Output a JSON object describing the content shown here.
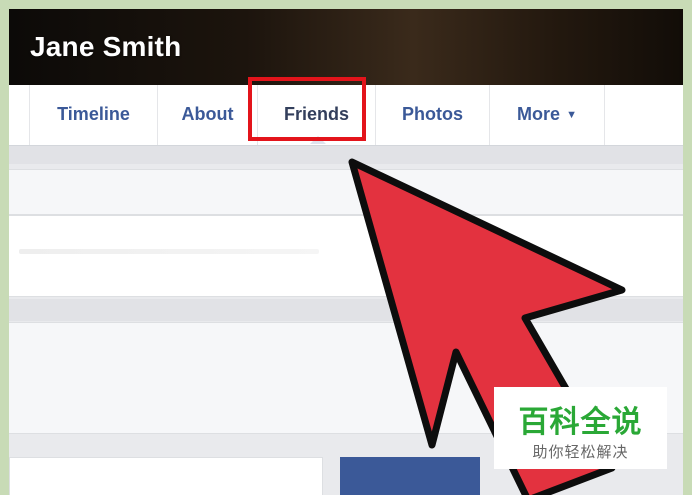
{
  "profile": {
    "name": "Jane Smith"
  },
  "tabs": [
    {
      "label": "Timeline"
    },
    {
      "label": "About"
    },
    {
      "label": "Friends",
      "highlighted": true
    },
    {
      "label": "Photos"
    },
    {
      "label": "More",
      "icon": "caret-down-icon"
    }
  ],
  "annotation": {
    "highlight_color": "#e3141b",
    "arrow_color": "#e3323f",
    "arrow_target": "Friends"
  },
  "watermark": {
    "title": "百科全说",
    "subtitle": "助你轻松解决",
    "color": "#2aa836"
  },
  "colors": {
    "link": "#3b5998",
    "background": "#e9eaed",
    "border": "#c8dbb6"
  }
}
